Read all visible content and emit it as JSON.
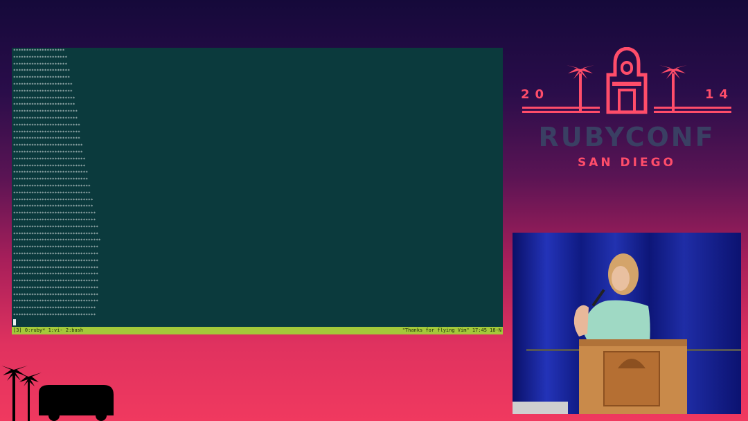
{
  "terminal": {
    "lines": [
      "********************",
      "*********************",
      "*********************",
      "**********************",
      "**********************",
      "***********************",
      "***********************",
      "************************",
      "************************",
      "*************************",
      "*************************",
      "**************************",
      "**************************",
      "**************************",
      "***************************",
      "***************************",
      "****************************",
      "****************************",
      "*****************************",
      "*****************************",
      "******************************",
      "******************************",
      "*******************************",
      "*******************************",
      "********************************",
      "********************************",
      "*********************************",
      "*********************************",
      "**********************************",
      "*********************************",
      "*********************************",
      "*********************************",
      "*********************************",
      "*********************************",
      "*********************************",
      "*********************************",
      "*********************************",
      "*********************************",
      "********************************",
      "********************************"
    ],
    "status_left": "[3] 0:ruby* 1:vi- 2:bash",
    "status_right": "\"Thanks for flying Vim\" 17:45 18-N"
  },
  "logo": {
    "year_left": "20",
    "year_right": "14",
    "title": "RUBYCONF",
    "city": "SAN DIEGO"
  },
  "colors": {
    "terminal_bg": "#0b3a3d",
    "status_bar": "#a4c93a",
    "accent_pink": "#ff4d6a",
    "logo_dark": "#3a3f63"
  }
}
